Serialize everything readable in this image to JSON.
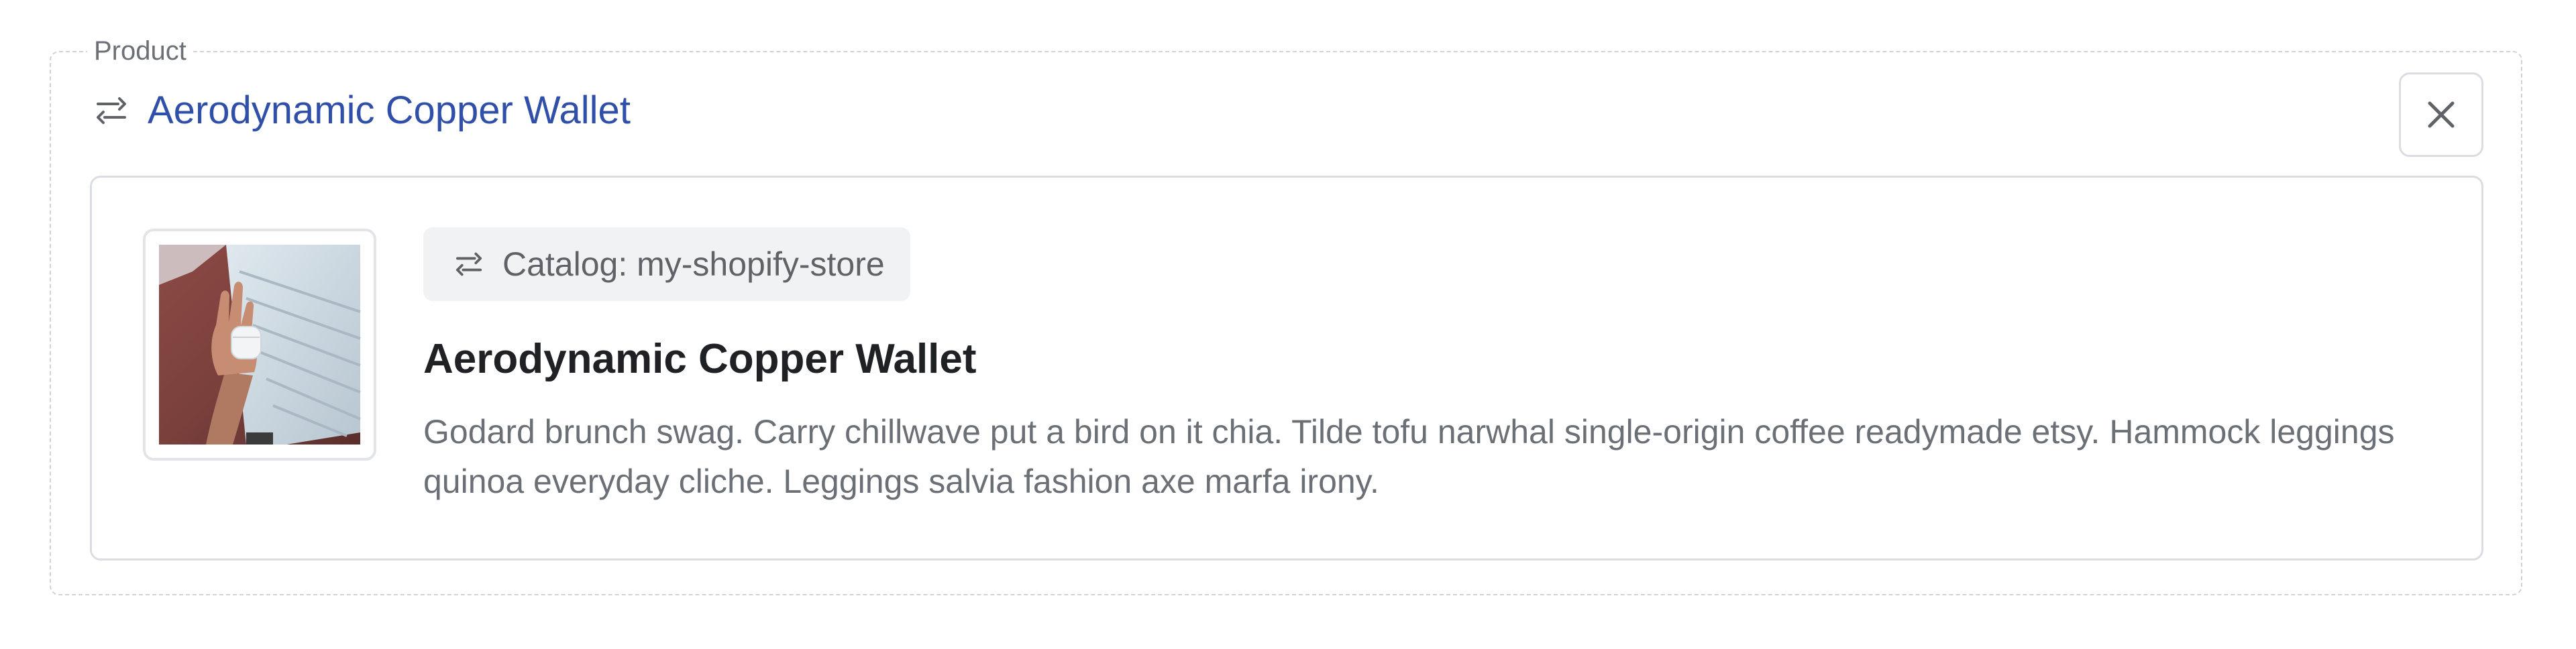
{
  "field": {
    "legend": "Product"
  },
  "header": {
    "title": "Aerodynamic Copper Wallet",
    "icon": "link-arrows-icon",
    "close_icon": "close-icon"
  },
  "card": {
    "thumbnail_alt": "Hand holding wireless earbuds case",
    "catalog_label": "Catalog: my-shopify-store",
    "title": "Aerodynamic Copper Wallet",
    "description": "Godard brunch swag. Carry chillwave put a bird on it chia. Tilde tofu narwhal single-origin coffee readymade etsy. Hammock leggings quinoa everyday cliche. Leggings salvia fashion axe marfa irony."
  },
  "colors": {
    "link": "#2f4fa8",
    "border": "#dadde1",
    "badge_bg": "#f1f2f3"
  }
}
